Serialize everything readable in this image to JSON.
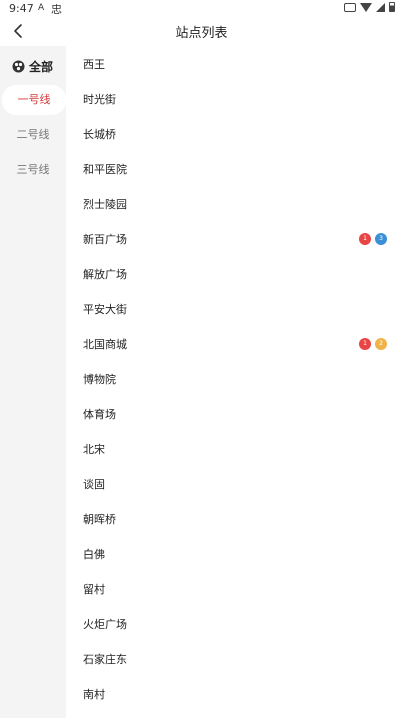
{
  "status_bar": {
    "time": "9:47",
    "notif_a": "A",
    "notif_b": "忠"
  },
  "header": {
    "title": "站点列表"
  },
  "sidebar": {
    "all_label": "全部",
    "lines": [
      {
        "label": "一号线",
        "active": true
      },
      {
        "label": "二号线",
        "active": false
      },
      {
        "label": "三号线",
        "active": false
      }
    ]
  },
  "stations": [
    {
      "name": "西王",
      "badges": []
    },
    {
      "name": "时光街",
      "badges": []
    },
    {
      "name": "长城桥",
      "badges": []
    },
    {
      "name": "和平医院",
      "badges": []
    },
    {
      "name": "烈士陵园",
      "badges": []
    },
    {
      "name": "新百广场",
      "badges": [
        {
          "text": "1",
          "color": "#e84545"
        },
        {
          "text": "3",
          "color": "#3a8fd6"
        }
      ]
    },
    {
      "name": "解放广场",
      "badges": []
    },
    {
      "name": "平安大街",
      "badges": []
    },
    {
      "name": "北国商城",
      "badges": [
        {
          "text": "1",
          "color": "#e84545"
        },
        {
          "text": "2",
          "color": "#f0b34a"
        }
      ]
    },
    {
      "name": "博物院",
      "badges": []
    },
    {
      "name": "体育场",
      "badges": []
    },
    {
      "name": "北宋",
      "badges": []
    },
    {
      "name": "谈固",
      "badges": []
    },
    {
      "name": "朝晖桥",
      "badges": []
    },
    {
      "name": "白佛",
      "badges": []
    },
    {
      "name": "留村",
      "badges": []
    },
    {
      "name": "火炬广场",
      "badges": []
    },
    {
      "name": "石家庄东",
      "badges": []
    },
    {
      "name": "南村",
      "badges": []
    }
  ],
  "colors": {
    "accent": "#d43a3a",
    "sidebar_bg": "#f4f4f4"
  }
}
